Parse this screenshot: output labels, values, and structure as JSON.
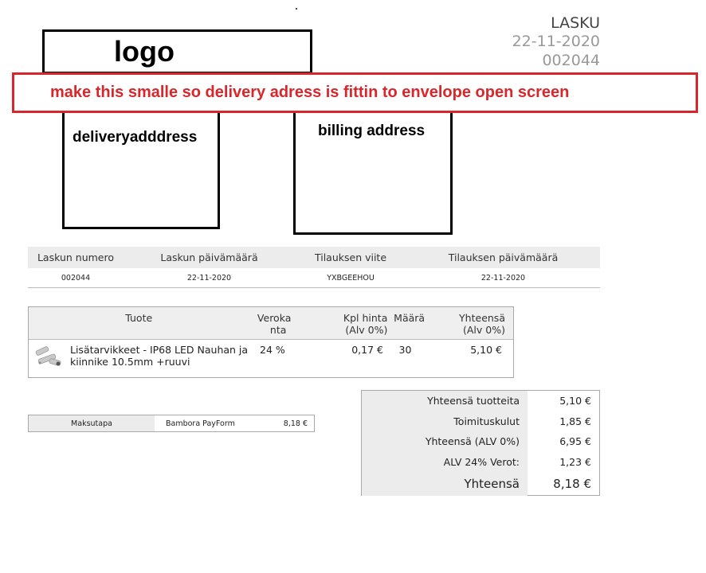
{
  "header": {
    "title": "LASKU",
    "date": "22-11-2020",
    "number": "002044"
  },
  "logo_placeholder": "logo",
  "annotation": "make this smalle so delivery adress is fittin to envelope open screen",
  "delivery_placeholder": "deliveryadddress",
  "billing_placeholder": "billing address",
  "order_info": {
    "headers": [
      "Laskun numero",
      "Laskun päivämäärä",
      "Tilauksen viite",
      "Tilauksen päivämäärä"
    ],
    "values": [
      "002044",
      "22-11-2020",
      "YXBGEEHOU",
      "22-11-2020"
    ]
  },
  "products": {
    "headers": {
      "product": "Tuote",
      "vat_line1": "Veroka",
      "vat_line2": "nta",
      "price_line1": "Kpl hinta",
      "price_line2": "(Alv 0%)",
      "qty": "Määrä",
      "total_line1": "Yhteensä",
      "total_line2": "(Alv 0%)"
    },
    "rows": [
      {
        "name_line1": "Lisätarvikkeet - IP68 LED Nauhan ja",
        "name_line2": "kiinnike 10.5mm +ruuvi",
        "vat": "24 %",
        "price": "0,17 €",
        "qty": "30",
        "total": "5,10 €"
      }
    ]
  },
  "payment": {
    "label": "Maksutapa",
    "method": "Bambora PayForm",
    "amount": "8,18 €"
  },
  "totals": [
    {
      "label": "Yhteensä tuotteita",
      "value": "5,10 €"
    },
    {
      "label": "Toimituskulut",
      "value": "1,85 €"
    },
    {
      "label": "Yhteensä (ALV 0%)",
      "value": "6,95 €"
    },
    {
      "label": "ALV 24% Verot:",
      "value": "1,23 €"
    },
    {
      "label": "Yhteensä",
      "value": "8,18 €"
    }
  ],
  "colors": {
    "annotation": "#d9262b",
    "header_bg": "#ececec"
  }
}
